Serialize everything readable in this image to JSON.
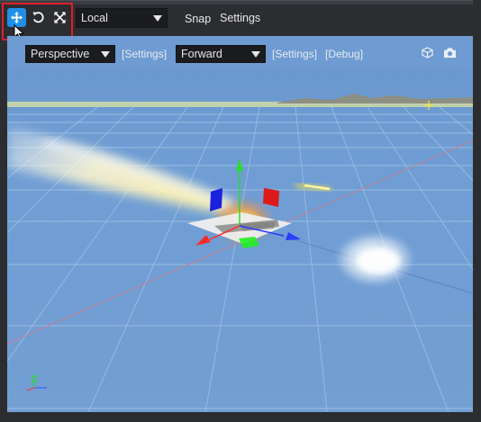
{
  "toolbar": {
    "tools": [
      {
        "name": "move-tool",
        "icon": "move-arrows-icon",
        "active": true
      },
      {
        "name": "rotate-tool",
        "icon": "rotate-icon",
        "active": false
      },
      {
        "name": "scale-tool",
        "icon": "scale-arrows-icon",
        "active": false
      }
    ],
    "space_dropdown": "Local",
    "snap_label": "Snap",
    "settings_label": "Settings"
  },
  "viewport_toolbar": {
    "projection_dropdown": "Perspective",
    "projection_settings": "[Settings]",
    "render_path_dropdown": "Forward",
    "render_settings": "[Settings]",
    "debug_label": "[Debug]",
    "right_icons": [
      "cube-icon",
      "camera-icon"
    ]
  },
  "colors": {
    "accent": "#1f8fe8",
    "highlight": "#e0202a",
    "sky": "#6e9bd1",
    "gizmo_x": "#ff2020",
    "gizmo_y": "#22dd22",
    "gizmo_z": "#2a3cff"
  }
}
